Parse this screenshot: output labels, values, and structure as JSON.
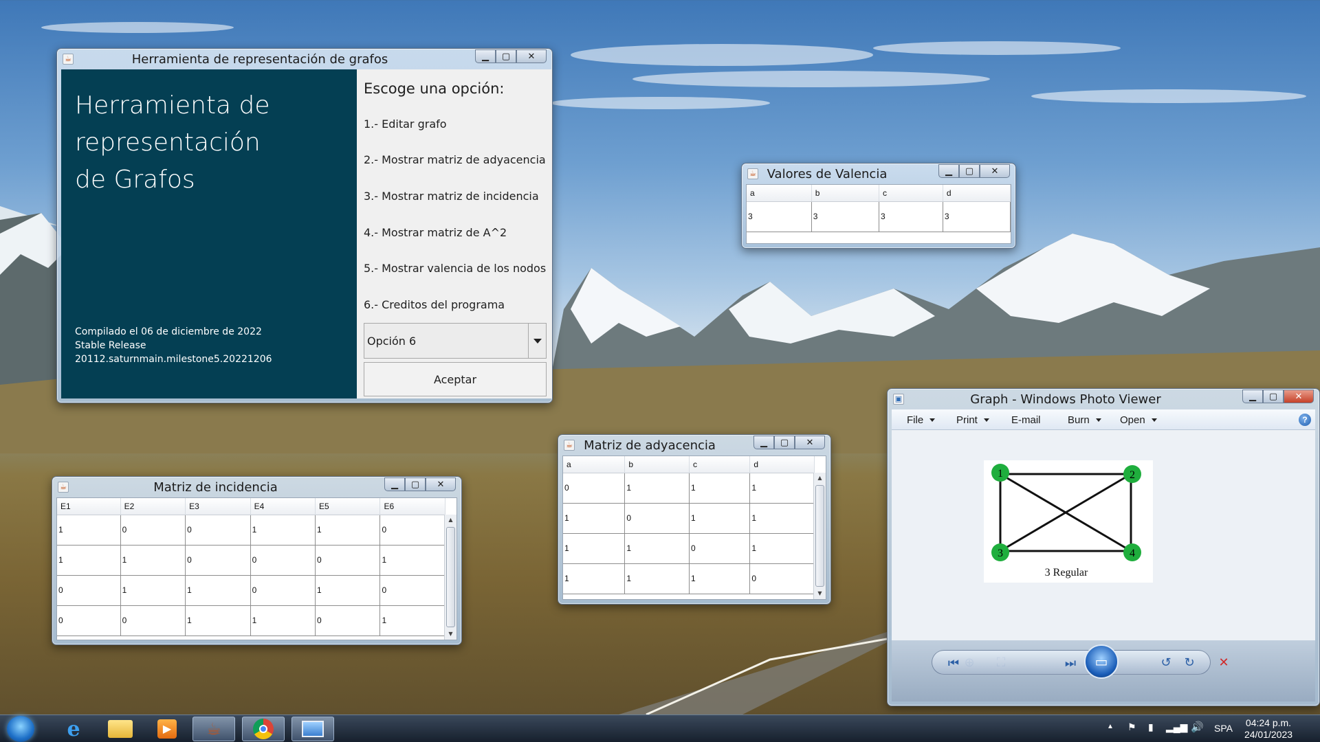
{
  "main_window": {
    "title": "Herramienta de representación de grafos",
    "heading": [
      "Herramienta de",
      "representación",
      "de Grafos"
    ],
    "build_info": [
      "Compilado el 06 de diciembre de 2022",
      "Stable Release",
      "20112.saturnmain.milestone5.20221206"
    ],
    "prompt": "Escoge una opción:",
    "options": [
      "1.- Editar grafo",
      "2.- Mostrar matriz de adyacencia",
      "3.- Mostrar matriz de incidencia",
      "4.- Mostrar matriz de A^2",
      "5.- Mostrar valencia de los nodos",
      "6.- Creditos del programa"
    ],
    "selected_option": "Opción 6",
    "accept_label": "Aceptar"
  },
  "valencia_window": {
    "title": "Valores de Valencia",
    "columns": [
      "a",
      "b",
      "c",
      "d"
    ],
    "rows": [
      [
        "3",
        "3",
        "3",
        "3"
      ]
    ]
  },
  "adyacencia_window": {
    "title": "Matriz de adyacencia",
    "columns": [
      "a",
      "b",
      "c",
      "d"
    ],
    "rows": [
      [
        "0",
        "1",
        "1",
        "1"
      ],
      [
        "1",
        "0",
        "1",
        "1"
      ],
      [
        "1",
        "1",
        "0",
        "1"
      ],
      [
        "1",
        "1",
        "1",
        "0"
      ]
    ]
  },
  "incidencia_window": {
    "title": "Matriz de incidencia",
    "columns": [
      "E1",
      "E2",
      "E3",
      "E4",
      "E5",
      "E6"
    ],
    "rows": [
      [
        "1",
        "0",
        "0",
        "1",
        "1",
        "0"
      ],
      [
        "1",
        "1",
        "0",
        "0",
        "0",
        "1"
      ],
      [
        "0",
        "1",
        "1",
        "0",
        "1",
        "0"
      ],
      [
        "0",
        "0",
        "1",
        "1",
        "0",
        "1"
      ]
    ]
  },
  "photo_viewer": {
    "title": "Graph - Windows Photo Viewer",
    "menu": [
      "File",
      "Print",
      "E-mail",
      "Burn",
      "Open"
    ],
    "help": "?",
    "graph_caption": "3 Regular",
    "node_labels": [
      "1",
      "2",
      "3",
      "4"
    ],
    "node_color": "#1fae3d"
  },
  "taskbar": {
    "pinned": [
      "internet-explorer",
      "windows-explorer",
      "media-player",
      "java",
      "chrome",
      "photo-viewer"
    ],
    "language": "SPA",
    "time": "04:24 p.m.",
    "date": "24/01/2023"
  }
}
